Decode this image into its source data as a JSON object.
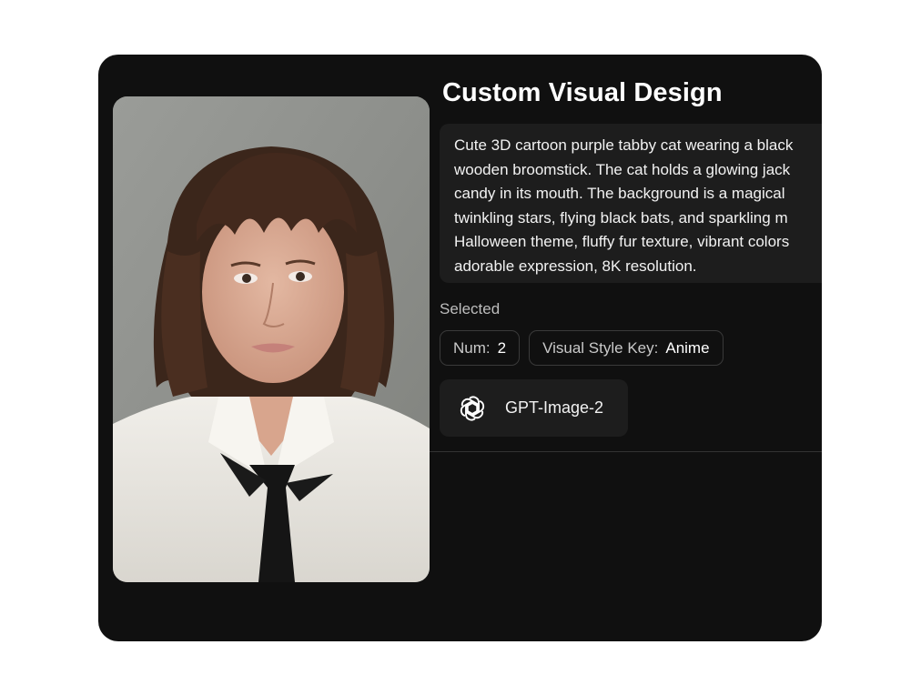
{
  "title": "Custom Visual Design",
  "prompt": {
    "lines": [
      "Cute 3D cartoon purple tabby cat wearing a black",
      "wooden broomstick. The cat holds a glowing jack",
      "candy in its mouth. The background is a magical",
      "twinkling stars, flying black bats, and sparkling m",
      "Halloween theme, fluffy fur texture, vibrant colors",
      "adorable expression, 8K resolution."
    ]
  },
  "selected": {
    "label": "Selected",
    "chips": [
      {
        "key": "Num:",
        "value": "2"
      },
      {
        "key": "Visual Style Key:",
        "value": "Anime"
      }
    ]
  },
  "model": {
    "name": "GPT-Image-2",
    "icon": "openai-logo-icon"
  },
  "colors": {
    "card_bg": "#101010",
    "panel_bg": "#1d1d1d",
    "text": "#ffffff"
  }
}
